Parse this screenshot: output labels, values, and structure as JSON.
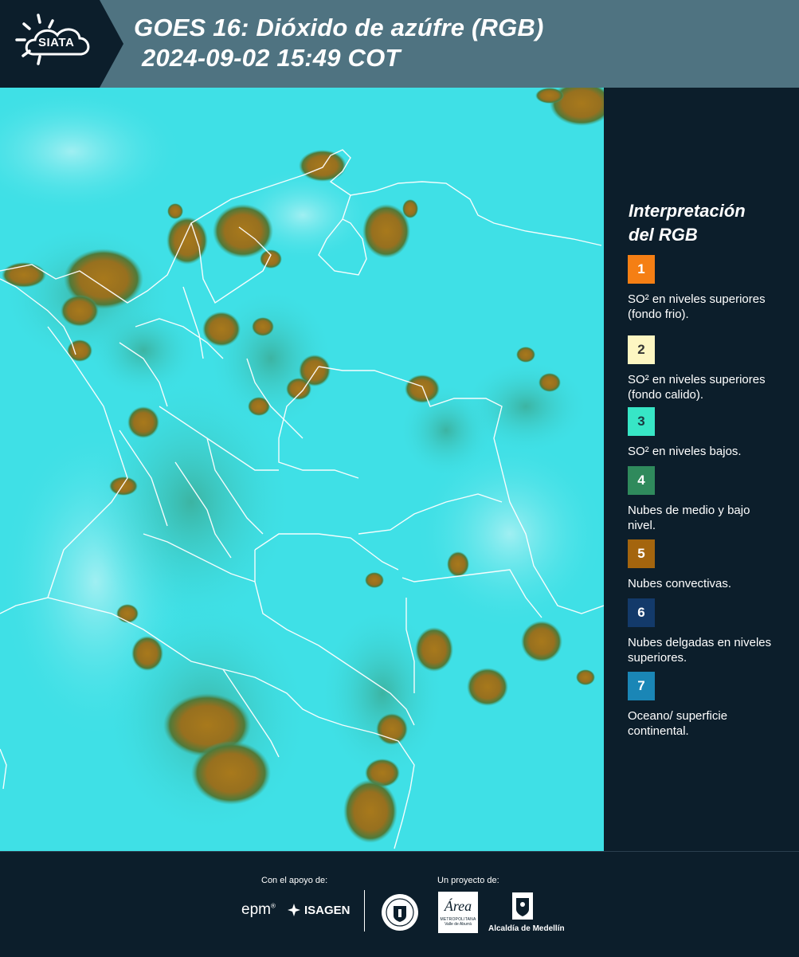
{
  "header": {
    "logo_text": "SIATA",
    "title_line1": "GOES 16: Dióxido de azúfre (RGB)",
    "title_line2": "2024-09-02 15:49 COT"
  },
  "legend": {
    "title_line1": "Interpretación",
    "title_line2": "del RGB",
    "items": [
      {
        "number": "1",
        "color": "#f57f14",
        "text_color": "#ffffff",
        "label": "SO² en niveles superiores (fondo frio)."
      },
      {
        "number": "2",
        "color": "#fdf6c2",
        "text_color": "#333333",
        "label": "SO² en niveles superiores (fondo calido)."
      },
      {
        "number": "3",
        "color": "#37e6c6",
        "text_color": "#1a3a40",
        "label": "SO² en niveles bajos."
      },
      {
        "number": "4",
        "color": "#2f8a5c",
        "text_color": "#ffffff",
        "label": "Nubes de medio y bajo nivel."
      },
      {
        "number": "5",
        "color": "#a4650e",
        "text_color": "#ffffff",
        "label": "Nubes convectivas."
      },
      {
        "number": "6",
        "color": "#133a6a",
        "text_color": "#ffffff",
        "label": "Nubes delgadas en niveles superiores."
      },
      {
        "number": "7",
        "color": "#1a86b6",
        "text_color": "#ffffff",
        "label": "Oceano/ superficie continental."
      }
    ]
  },
  "footer": {
    "support_label": "Con el apoyo de:",
    "project_label": "Un proyecto de:",
    "sponsor_epm": "epm",
    "sponsor_isagen": "ISAGEN",
    "partner_area_line1": "Área",
    "partner_area_line2": "METROPOLITANA",
    "partner_area_line3": "Valle de Aburrá",
    "partner_alcaldia": "Alcaldía de Medellín"
  }
}
